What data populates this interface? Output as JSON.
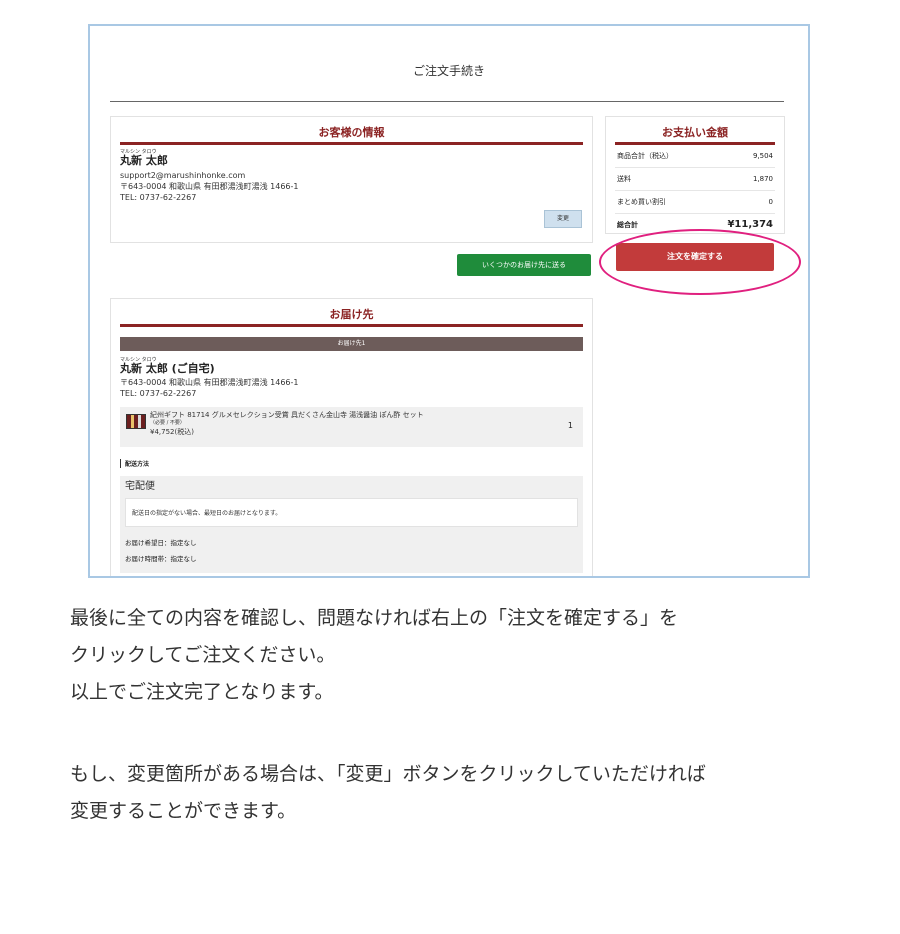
{
  "screenshot": {
    "page_title": "ご注文手続き",
    "customer": {
      "heading": "お客様の情報",
      "name_ruby": "マルシン タロウ",
      "name": "丸新 太郎",
      "email": "support2@marushinhonke.com",
      "address": "〒643-0004 和歌山県 有田郡湯浅町湯浅 1466-1",
      "tel": "TEL: 0737-62-2267",
      "change_label": "変更"
    },
    "multi_ship_label": "いくつかのお届け先に送る",
    "payment": {
      "heading": "お支払い金額",
      "rows": [
        {
          "label": "商品合計（税込）",
          "value": "9,504"
        },
        {
          "label": "送料",
          "value": "1,870"
        },
        {
          "label": "まとめ買い割引",
          "value": "0"
        },
        {
          "label": "総合計",
          "value": "¥11,374"
        }
      ],
      "confirm_label": "注文を確定する"
    },
    "delivery": {
      "heading": "お届け先",
      "tab_label": "お届け先1",
      "name_ruby": "マルシン タロウ",
      "name": "丸新 太郎 (ご自宅)",
      "address": "〒643-0004 和歌山県 有田郡湯浅町湯浅 1466-1",
      "tel": "TEL: 0737-62-2267",
      "product": {
        "title": "紀州ギフト 81714 グルメセレクション受賞 具だくさん金山寺 湯浅醤油 ぽん酢 セット",
        "option": "（必要 / 不要）",
        "price": "¥4,752(税込)",
        "quantity": "1"
      },
      "method_label": "配送方法",
      "method_name": "宅配便",
      "notice": "配送日の指定がない場合、最短日のお届けとなります。",
      "date_label": "お届け希望日：指定なし",
      "time_label": "お届け時間帯：指定なし"
    }
  },
  "instructions": {
    "line1": "最後に全ての内容を確認し、問題なければ右上の「注文を確定する」を",
    "line2": "クリックしてご注文ください。",
    "line3": "以上でご注文完了となります。",
    "line4": "もし、変更箇所がある場合は、「変更」ボタンをクリックしていただければ",
    "line5": "変更することができます。"
  },
  "colors": {
    "accent": "#8b2323",
    "confirm_button": "#c23b3b",
    "multi_ship_button": "#1f8c3b",
    "highlight_circle": "#e0207f",
    "screenshot_border": "#a9c8e4"
  }
}
